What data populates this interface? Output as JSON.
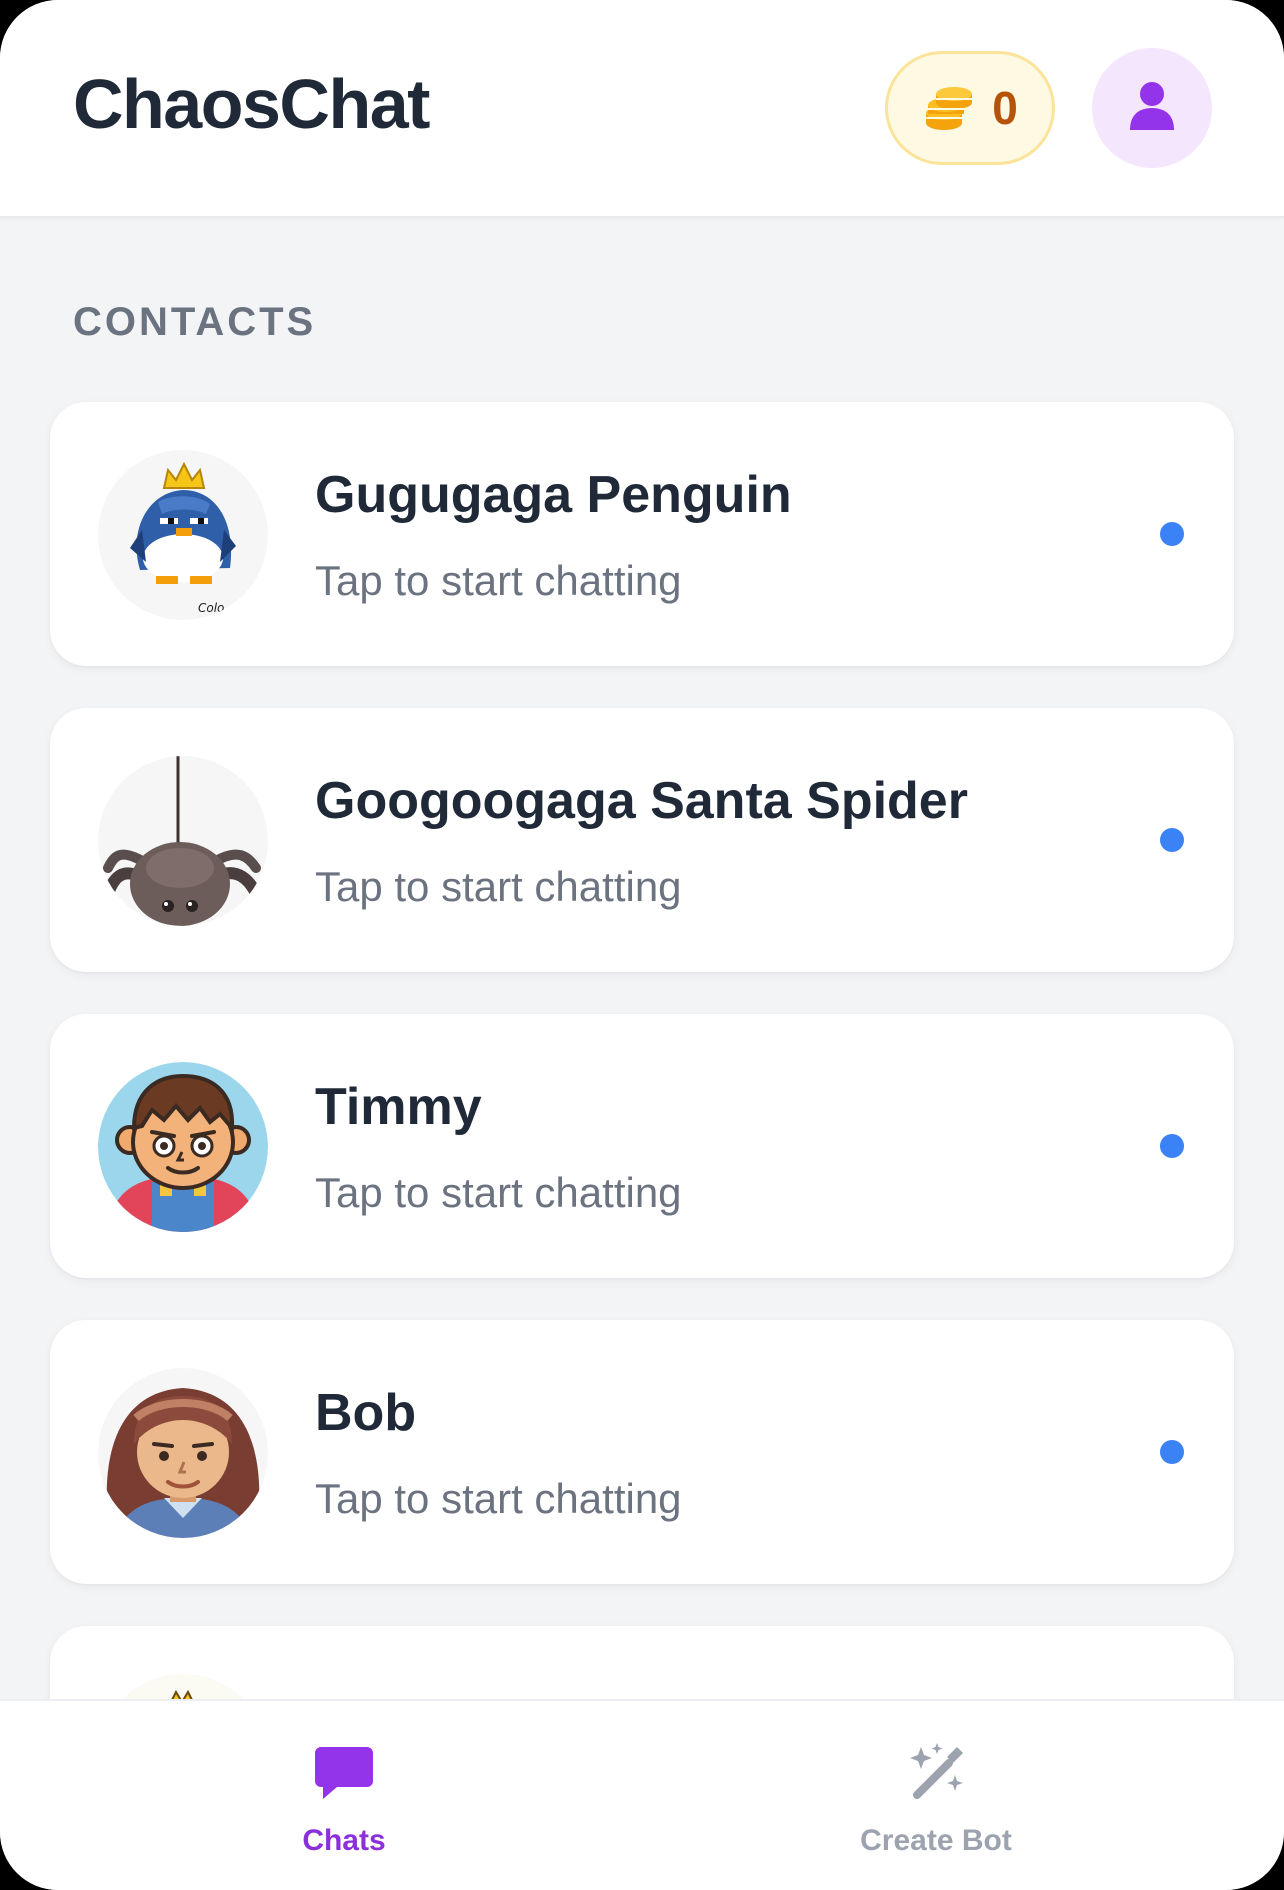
{
  "header": {
    "app_title": "ChaosChat",
    "coin_count": "0",
    "coin_icon": "coins-icon",
    "profile_icon": "user-icon"
  },
  "contacts": {
    "section_title": "CONTACTS",
    "items": [
      {
        "name": "Gugugaga Penguin",
        "subtitle": "Tap to start chatting",
        "avatar": "penguin-avatar",
        "status": "online"
      },
      {
        "name": "Googoogaga Santa Spider",
        "subtitle": "Tap to start chatting",
        "avatar": "spider-avatar",
        "status": "online"
      },
      {
        "name": "Timmy",
        "subtitle": "Tap to start chatting",
        "avatar": "boy-avatar",
        "status": "online"
      },
      {
        "name": "Bob",
        "subtitle": "Tap to start chatting",
        "avatar": "girl-avatar",
        "status": "online"
      }
    ]
  },
  "nav": {
    "chats_label": "Chats",
    "create_bot_label": "Create Bot",
    "active": "chats"
  },
  "colors": {
    "accent": "#8b2fd9",
    "status_dot": "#3b82f6",
    "coin": "#f59e0b",
    "coin_text": "#b45309",
    "title": "#1f2937",
    "muted": "#6b7280"
  }
}
